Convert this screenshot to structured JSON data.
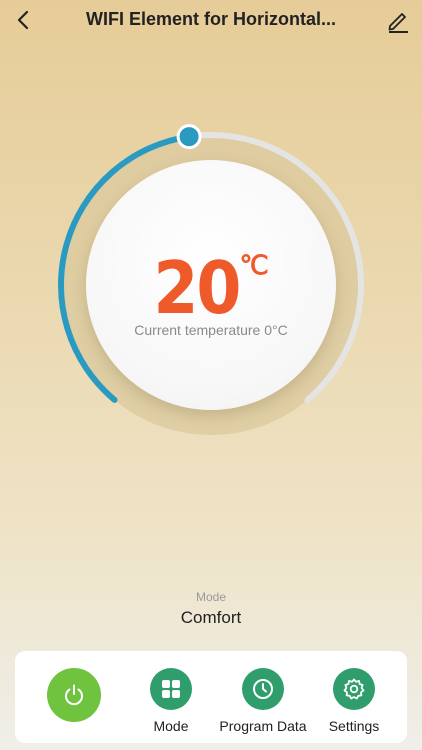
{
  "header": {
    "title": "WIFI Element for Horizontal...",
    "back_icon": "chevron-left-icon",
    "edit_icon": "pencil-icon"
  },
  "thermostat": {
    "set_temperature": "20",
    "unit": "℃",
    "current_temperature_text": "Current temperature 0°C",
    "setpoint_fraction": 0.47,
    "colors": {
      "arc": "#2a9ac1",
      "temperature": "#ef5a2a",
      "track": "#e4e4e4"
    }
  },
  "mode": {
    "label": "Mode",
    "value": "Comfort"
  },
  "bottom_nav": {
    "power_icon": "power-icon",
    "power_color": "#6fc33f",
    "items": [
      {
        "label": "Mode",
        "icon": "grid-icon"
      },
      {
        "label": "Program Data",
        "icon": "clock-icon"
      },
      {
        "label": "Settings",
        "icon": "gear-icon"
      }
    ],
    "item_color": "#2f9e6c"
  }
}
